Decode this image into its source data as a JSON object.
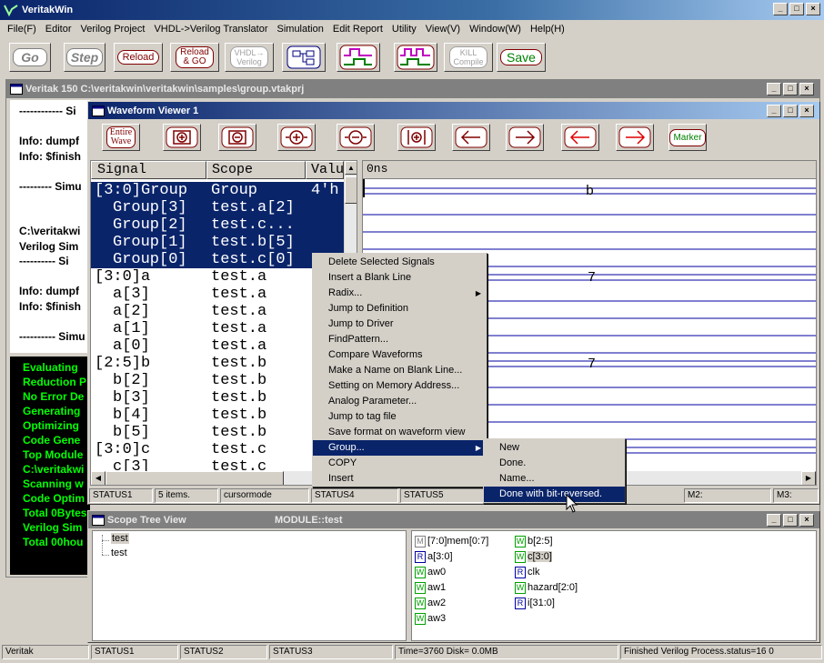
{
  "app": {
    "title": "VeritakWin",
    "menu": [
      "File(F)",
      "Editor",
      "Verilog Project",
      "VHDL->Verilog Translator",
      "Simulation",
      "Edit Report",
      "Utility",
      "View(V)",
      "Window(W)",
      "Help(H)"
    ]
  },
  "toolbar": {
    "go": "Go",
    "step": "Step",
    "reload": "Reload",
    "reload_go_1": "Reload",
    "reload_go_2": "& GO",
    "vhdl_1": "VHDL",
    "vhdl_2": "Verilog",
    "kill_1": "KILL",
    "kill_2": "Compile",
    "save": "Save"
  },
  "console": {
    "title": "Veritak 150 C:\\veritakwin\\veritakwin\\samples\\group.vtakprj",
    "lines": [
      "------------ Si",
      "",
      "Info: dumpf",
      "Info: $finish",
      "",
      "--------- Simu",
      "",
      "",
      "C:\\veritakwi",
      "Verilog Sim",
      "---------- Si",
      "",
      "Info: dumpf",
      "Info: $finish",
      "",
      "---------- Simu"
    ],
    "green_lines": [
      "Evaluating",
      "Reduction P",
      "No Error De",
      "Generating",
      "Optimizing",
      "Code Gene",
      "Top Module",
      "C:\\veritakwi",
      "Scanning w",
      "Code Optim",
      "Total 0Bytes",
      "Verilog Sim",
      "Total  00hou"
    ]
  },
  "waveform": {
    "title": "Waveform Viewer 1",
    "buttons": {
      "entire_1": "Entire",
      "entire_2": "Wave",
      "marker": "Marker"
    },
    "headers": {
      "signal": "Signal",
      "scope": "Scope",
      "value": "Valu",
      "time": "0ns"
    },
    "rows": [
      {
        "signal": "[3:0]Group",
        "scope": "Group",
        "value": "4'h",
        "selected": true,
        "indent": false
      },
      {
        "signal": "Group[3]",
        "scope": "test.a[2]",
        "value": "",
        "selected": true,
        "indent": true
      },
      {
        "signal": "Group[2]",
        "scope": "test.c...",
        "value": "",
        "selected": true,
        "indent": true
      },
      {
        "signal": "Group[1]",
        "scope": "test.b[5]",
        "value": "",
        "selected": true,
        "indent": true
      },
      {
        "signal": "Group[0]",
        "scope": "test.c[0]",
        "value": "",
        "selected": true,
        "indent": true
      },
      {
        "signal": "[3:0]a",
        "scope": "test.a",
        "value": "",
        "selected": false,
        "indent": false
      },
      {
        "signal": "a[3]",
        "scope": "test.a",
        "value": "",
        "selected": false,
        "indent": true
      },
      {
        "signal": "a[2]",
        "scope": "test.a",
        "value": "",
        "selected": false,
        "indent": true
      },
      {
        "signal": "a[1]",
        "scope": "test.a",
        "value": "",
        "selected": false,
        "indent": true
      },
      {
        "signal": "a[0]",
        "scope": "test.a",
        "value": "",
        "selected": false,
        "indent": true
      },
      {
        "signal": "[2:5]b",
        "scope": "test.b",
        "value": "",
        "selected": false,
        "indent": false
      },
      {
        "signal": "b[2]",
        "scope": "test.b",
        "value": "",
        "selected": false,
        "indent": true
      },
      {
        "signal": "b[3]",
        "scope": "test.b",
        "value": "",
        "selected": false,
        "indent": true
      },
      {
        "signal": "b[4]",
        "scope": "test.b",
        "value": "",
        "selected": false,
        "indent": true
      },
      {
        "signal": "b[5]",
        "scope": "test.b",
        "value": "",
        "selected": false,
        "indent": true
      },
      {
        "signal": "[3:0]c",
        "scope": "test.c",
        "value": "",
        "selected": false,
        "indent": false
      },
      {
        "signal": "c[3]",
        "scope": "test.c",
        "value": "",
        "selected": false,
        "indent": true
      }
    ],
    "wave_labels": {
      "b_label": "b",
      "seven_1": "7",
      "seven_2": "7"
    },
    "status": {
      "s1": "STATUS1",
      "s2": "5 items.",
      "s3": "cursormode",
      "s4": "STATUS4",
      "s5": "STATUS5",
      "m2": "M2:",
      "m3": "M3:"
    }
  },
  "context_menu": {
    "items": [
      "Delete Selected Signals",
      "Insert a Blank Line",
      "Radix...",
      "Jump to Definition",
      "Jump to Driver",
      "FindPattern...",
      "Compare Waveforms",
      "Make a Name on Blank Line...",
      "Setting on Memory Address...",
      "Analog Parameter...",
      "Jump to tag file",
      "Save format on waveform view",
      "Group...",
      "COPY",
      "Insert"
    ],
    "submenu": [
      "New",
      "Done.",
      "Name...",
      "Done with bit-reversed."
    ]
  },
  "scope_tree": {
    "title": "Scope Tree View",
    "module": "MODULE::test",
    "tree": [
      "test",
      "test"
    ],
    "vars_left": [
      {
        "tag": "M",
        "name": "[7:0]mem[0:7]"
      },
      {
        "tag": "R",
        "name": "a[3:0]"
      },
      {
        "tag": "W",
        "name": "aw0"
      },
      {
        "tag": "W",
        "name": "aw1"
      },
      {
        "tag": "W",
        "name": "aw2"
      },
      {
        "tag": "W",
        "name": "aw3"
      }
    ],
    "vars_right": [
      {
        "tag": "W",
        "name": "b[2:5]"
      },
      {
        "tag": "W",
        "name": "c[3:0]"
      },
      {
        "tag": "R",
        "name": "clk"
      },
      {
        "tag": "W",
        "name": "hazard[2:0]"
      },
      {
        "tag": "R",
        "name": "i[31:0]"
      }
    ]
  },
  "statusbar": {
    "app": "Veritak",
    "s1": "STATUS1",
    "s2": "STATUS2",
    "s3": "STATUS3",
    "time": "Time=3760 Disk=  0.0MB",
    "finished": "Finished Verilog Process.status=16 0"
  }
}
